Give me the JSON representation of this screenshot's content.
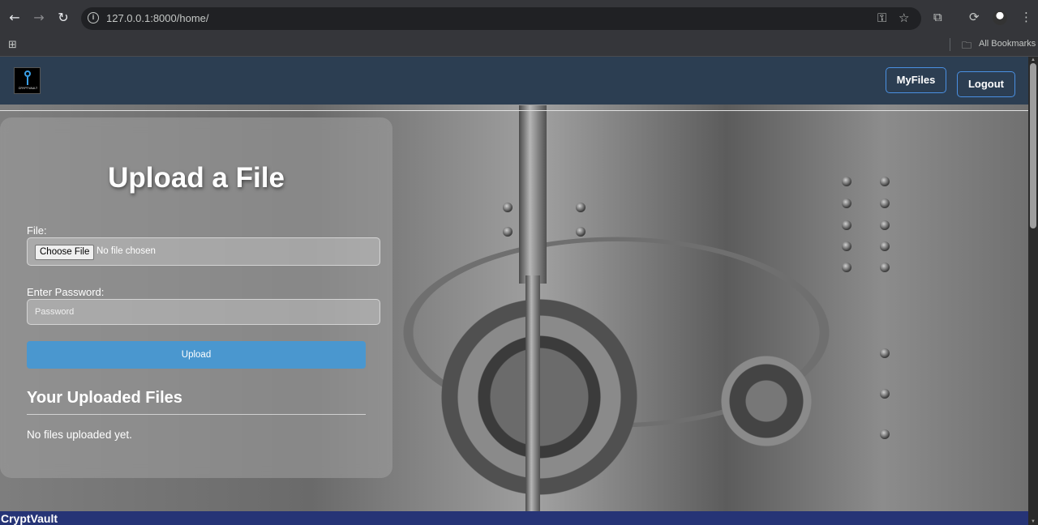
{
  "browser": {
    "url": "127.0.0.1:8000/home/",
    "bookmarks_label": "All Bookmarks"
  },
  "navbar": {
    "logo_text": "CRYPTVAULT",
    "myfiles_label": "MyFiles",
    "logout_label": "Logout"
  },
  "upload_card": {
    "title": "Upload a File",
    "file_label": "File:",
    "choose_file_label": "Choose File",
    "no_file_text": "No file chosen",
    "password_label": "Enter Password:",
    "password_placeholder": "Password",
    "upload_button_label": "Upload",
    "uploaded_heading": "Your Uploaded Files",
    "no_files_text": "No files uploaded yet."
  },
  "footer": {
    "text": "CryptVault"
  },
  "colors": {
    "navbar_bg": "#2c3e52",
    "button_border": "#4a90e2",
    "upload_button": "#4a97cf",
    "footer_bg": "#263476"
  }
}
